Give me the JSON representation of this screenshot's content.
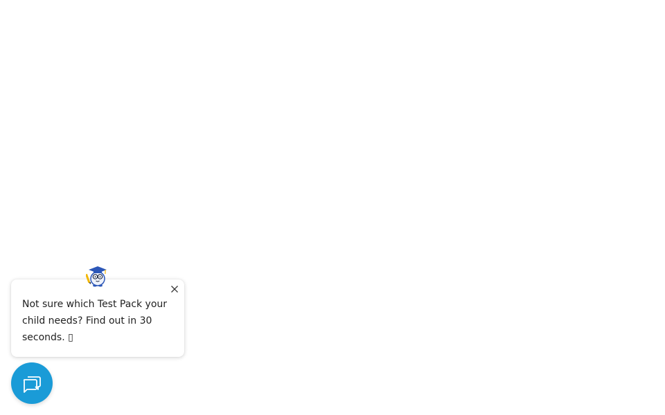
{
  "chat_popup": {
    "message": "Not sure which Test Pack your child needs? Find out in 30 seconds. ▯",
    "close_icon": "close-icon",
    "avatar_icon": "graduate-mascot-icon"
  },
  "chat_launcher": {
    "icon": "chat-bubbles-icon",
    "color": "#1a9bd7"
  }
}
